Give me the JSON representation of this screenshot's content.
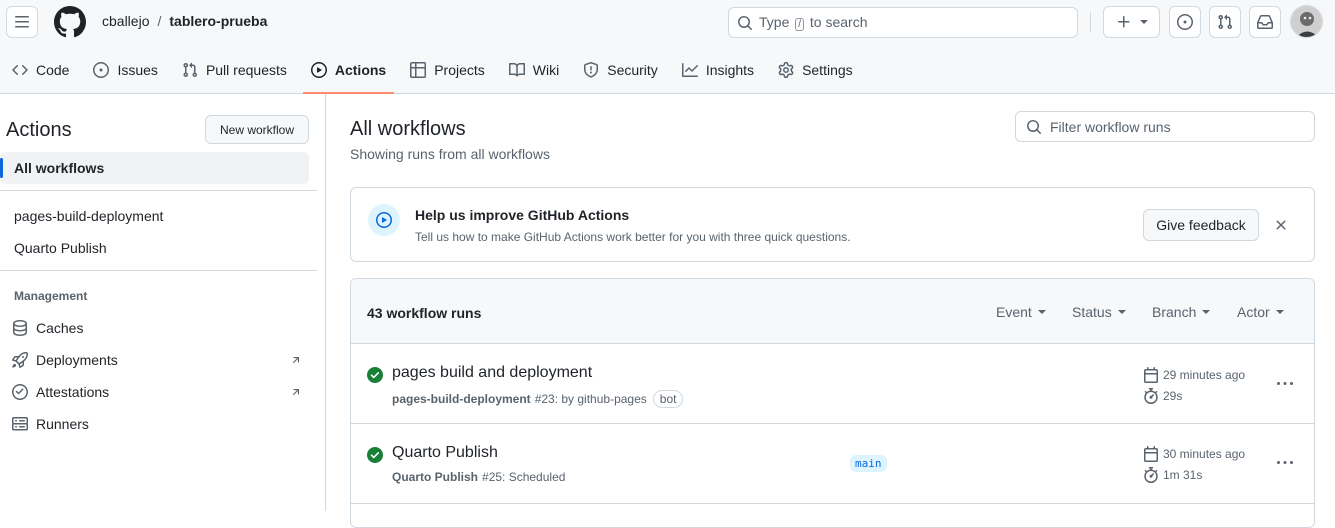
{
  "header": {
    "owner": "cballejo",
    "separator": "/",
    "repo": "tablero-prueba",
    "search_before": "Type",
    "search_key": "/",
    "search_after": "to search"
  },
  "tabs": [
    {
      "label": "Code",
      "icon": "code-icon"
    },
    {
      "label": "Issues",
      "icon": "issue-icon"
    },
    {
      "label": "Pull requests",
      "icon": "pull-request-icon"
    },
    {
      "label": "Actions",
      "icon": "play-icon",
      "active": true
    },
    {
      "label": "Projects",
      "icon": "table-icon"
    },
    {
      "label": "Wiki",
      "icon": "book-icon"
    },
    {
      "label": "Security",
      "icon": "shield-icon"
    },
    {
      "label": "Insights",
      "icon": "graph-icon"
    },
    {
      "label": "Settings",
      "icon": "gear-icon"
    }
  ],
  "sidebar": {
    "title": "Actions",
    "new_workflow": "New workflow",
    "all_workflows": "All workflows",
    "workflows": [
      "pages-build-deployment",
      "Quarto Publish"
    ],
    "management_heading": "Management",
    "management": [
      {
        "label": "Caches",
        "icon": "database-icon"
      },
      {
        "label": "Deployments",
        "icon": "rocket-icon",
        "external": true
      },
      {
        "label": "Attestations",
        "icon": "verified-icon",
        "external": true
      },
      {
        "label": "Runners",
        "icon": "server-icon"
      }
    ]
  },
  "main": {
    "title": "All workflows",
    "subtitle": "Showing runs from all workflows",
    "filter_placeholder": "Filter workflow runs"
  },
  "banner": {
    "title": "Help us improve GitHub Actions",
    "text": "Tell us how to make GitHub Actions work better for you with three quick questions.",
    "button": "Give feedback"
  },
  "runs": {
    "count_label": "43 workflow runs",
    "filters": [
      "Event",
      "Status",
      "Branch",
      "Actor"
    ],
    "items": [
      {
        "title": "pages build and deployment",
        "workflow": "pages-build-deployment",
        "detail": "#23: by github-pages",
        "badge": "bot",
        "branch": "",
        "time_ago": "29 minutes ago",
        "duration": "29s",
        "status": "success"
      },
      {
        "title": "Quarto Publish",
        "workflow": "Quarto Publish",
        "detail": "#25: Scheduled",
        "badge": "",
        "branch": "main",
        "time_ago": "30 minutes ago",
        "duration": "1m 31s",
        "status": "success"
      }
    ]
  },
  "colors": {
    "accent": "#0969da",
    "success": "#1a7f37",
    "tab_underline": "#fd8c73"
  }
}
